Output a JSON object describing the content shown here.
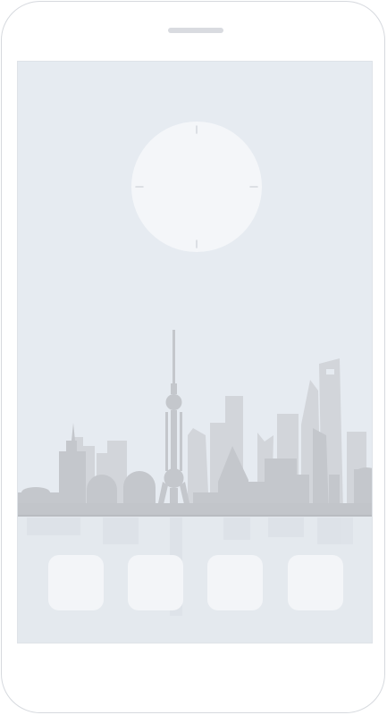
{
  "device": {
    "frame_color": "#d6d9de",
    "speaker_color": "#d9dbe0"
  },
  "screen": {
    "background": "#e6ebf1",
    "wallpaper": "city-skyline",
    "clock": {
      "type": "analog",
      "face_color": "#f4f6f9",
      "tick_color": "#d3d7dd"
    },
    "dock": {
      "icons": [
        {
          "name": "app-icon-1"
        },
        {
          "name": "app-icon-2"
        },
        {
          "name": "app-icon-3"
        },
        {
          "name": "app-icon-4"
        }
      ],
      "icon_color": "#f3f5f8"
    }
  }
}
